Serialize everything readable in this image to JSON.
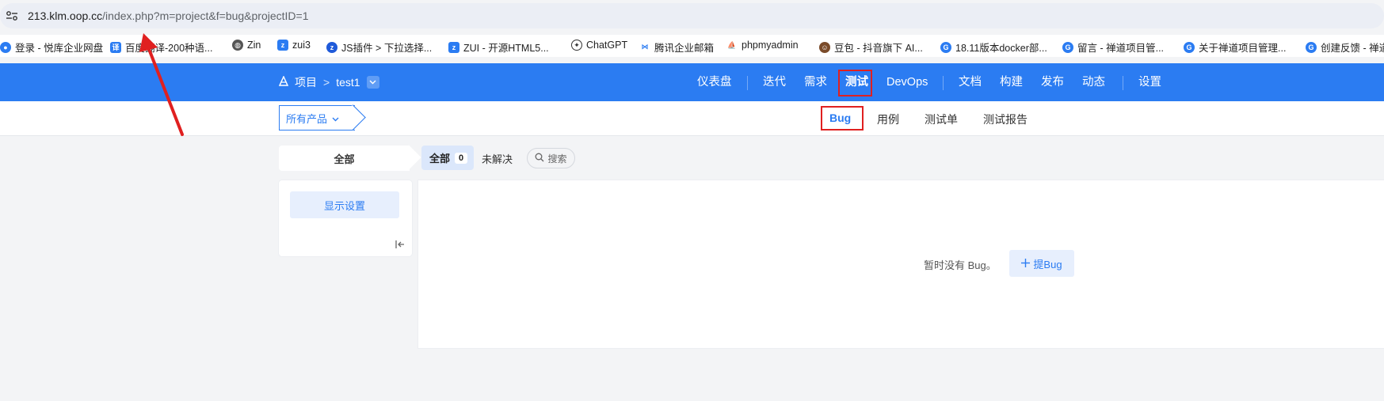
{
  "browser": {
    "url_host": "213.klm.oop.cc",
    "url_path": "/index.php?m=project&f=bug&projectID=1",
    "bookmarks": [
      {
        "label": "登录 - 悦库企业网盘",
        "icon": "cloud-icon",
        "color": "#2b7cf2"
      },
      {
        "label": "百度翻译-200种语...",
        "icon": "translate-icon",
        "color": "#2b7cf2"
      },
      {
        "label": "Zin",
        "icon": "globe-icon",
        "color": "#555555"
      },
      {
        "label": "zui3",
        "icon": "z-icon",
        "color": "#2b7cf2"
      },
      {
        "label": "JS插件 > 下拉选择...",
        "icon": "z-icon",
        "color": "#1f5ad9"
      },
      {
        "label": "ZUI - 开源HTML5...",
        "icon": "z-icon",
        "color": "#2b7cf2"
      },
      {
        "label": "ChatGPT",
        "icon": "chatgpt-icon",
        "color": "#333333"
      },
      {
        "label": "腾讯企业邮箱",
        "icon": "mail-icon",
        "color": "#2b7cf2"
      },
      {
        "label": "phpmyadmin",
        "icon": "phpmyadmin-icon",
        "color": "#e49a2e"
      },
      {
        "label": "豆包 - 抖音旗下 AI...",
        "icon": "doubao-icon",
        "color": "#7a4b2a"
      },
      {
        "label": "18.11版本docker部...",
        "icon": "zentao-icon",
        "color": "#2b7cf2"
      },
      {
        "label": "留言 - 禅道项目管...",
        "icon": "zentao-icon",
        "color": "#2b7cf2"
      },
      {
        "label": "关于禅道项目管理...",
        "icon": "zentao-icon",
        "color": "#2b7cf2"
      },
      {
        "label": "创建反馈 - 禅道",
        "icon": "zentao-icon",
        "color": "#2b7cf2"
      }
    ]
  },
  "header": {
    "breadcrumb_root": "项目",
    "breadcrumb_sep": ">",
    "project_name": "test1",
    "nav": [
      {
        "label": "仪表盘"
      },
      {
        "label": "迭代"
      },
      {
        "label": "需求"
      },
      {
        "label": "测试",
        "active": true
      },
      {
        "label": "DevOps"
      },
      {
        "label": "文档"
      },
      {
        "label": "构建"
      },
      {
        "label": "发布"
      },
      {
        "label": "动态"
      },
      {
        "label": "设置"
      }
    ],
    "accent": "#2b7cf2"
  },
  "subheader": {
    "product_select": "所有产品",
    "tabs": [
      {
        "label": "Bug",
        "active": true
      },
      {
        "label": "用例"
      },
      {
        "label": "测试单"
      },
      {
        "label": "测试报告"
      }
    ]
  },
  "filters": {
    "side_tab": "全部",
    "all_label": "全部",
    "all_count": "0",
    "unresolved_label": "未解决",
    "search_label": "搜索"
  },
  "left_panel": {
    "display_settings": "显示设置"
  },
  "main": {
    "empty_text": "暂时没有 Bug。",
    "add_bug_label": "提Bug"
  },
  "annotation_color": "#e02020"
}
